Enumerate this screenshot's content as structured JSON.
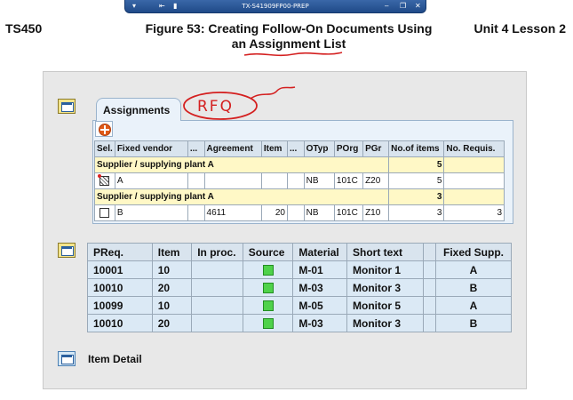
{
  "session": {
    "title": "TX-S41909FP00-PREP"
  },
  "header": {
    "course": "TS450",
    "figure_title_line1": "Figure 53: Creating Follow-On Documents Using",
    "figure_title_line2": "an Assignment List",
    "unit": "Unit 4 Lesson 2"
  },
  "annotation": {
    "handwritten": "RFQ"
  },
  "assignments": {
    "tab_label": "Assignments",
    "columns": [
      "Sel.",
      "Fixed vendor",
      "...",
      "Agreement",
      "Item",
      "...",
      "OTyp",
      "POrg",
      "PGr",
      "No.of items",
      "No. Requis."
    ],
    "groups": [
      {
        "label": "Supplier / supplying plant A",
        "count": "5",
        "row": {
          "vendor": "A",
          "agreement": "",
          "item": "",
          "otyp": "NB",
          "porg": "101C",
          "pgr": "Z20",
          "items": "5",
          "requis": ""
        }
      },
      {
        "label": "Supplier / supplying plant A",
        "count": "3",
        "row": {
          "vendor": "B",
          "agreement": "4611",
          "item": "20",
          "otyp": "NB",
          "porg": "101C",
          "pgr": "Z10",
          "items": "3",
          "requis": "3"
        }
      }
    ]
  },
  "requisitions": {
    "columns": [
      "PReq.",
      "Item",
      "In proc.",
      "Source",
      "Material",
      "Short text",
      "",
      "Fixed Supp."
    ],
    "rows": [
      {
        "preq": "10001",
        "item": "10",
        "material": "M-01",
        "short_text": "Monitor 1",
        "fixed_supp": "A"
      },
      {
        "preq": "10010",
        "item": "20",
        "material": "M-03",
        "short_text": "Monitor 3",
        "fixed_supp": "B"
      },
      {
        "preq": "10099",
        "item": "10",
        "material": "M-05",
        "short_text": "Monitor 5",
        "fixed_supp": "A"
      },
      {
        "preq": "10010",
        "item": "20",
        "material": "M-03",
        "short_text": "Monitor 3",
        "fixed_supp": "B"
      }
    ]
  },
  "item_detail": {
    "label": "Item Detail"
  },
  "colors": {
    "group_row": "#fff8c6",
    "source_green": "#4fd24a",
    "annotation_red": "#d42020"
  }
}
